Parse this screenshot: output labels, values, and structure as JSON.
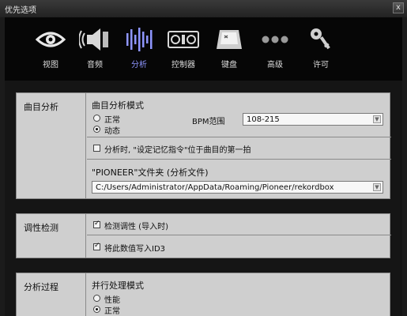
{
  "window": {
    "title": "优先选项",
    "close_glyph": "x"
  },
  "toolbar": {
    "items": [
      {
        "label": "视图",
        "icon": "eye-icon"
      },
      {
        "label": "音频",
        "icon": "speaker-icon"
      },
      {
        "label": "分析",
        "icon": "waveform-icon",
        "active": true
      },
      {
        "label": "控制器",
        "icon": "controller-icon"
      },
      {
        "label": "键盘",
        "icon": "keyboard-key-icon"
      },
      {
        "label": "高级",
        "icon": "dots-icon"
      },
      {
        "label": "许可",
        "icon": "key-icon"
      }
    ],
    "active_color": "#8f96ff"
  },
  "track_analysis": {
    "category": "曲目分析",
    "mode_title": "曲目分析模式",
    "option_normal": "正常",
    "option_dynamic": "动态",
    "selected_mode": "动态",
    "bpm_label": "BPM范围",
    "bpm_value": "108-215",
    "cue_checkbox_label": "分析时, \"设定记忆指令\"位于曲目的第一拍",
    "cue_checked": false,
    "folder_title": "\"PIONEER\"文件夹 (分析文件)",
    "folder_path": "C:/Users/Administrator/AppData/Roaming/Pioneer/rekordbox"
  },
  "key_detection": {
    "category": "调性检测",
    "detect_label": "检测调性 (导入时)",
    "detect_checked": true,
    "write_id3_label": "将此数值写入ID3",
    "write_id3_checked": true
  },
  "analysis_process": {
    "category": "分析过程",
    "title": "并行处理模式",
    "option_performance": "性能",
    "option_normal": "正常",
    "selected": "正常"
  }
}
